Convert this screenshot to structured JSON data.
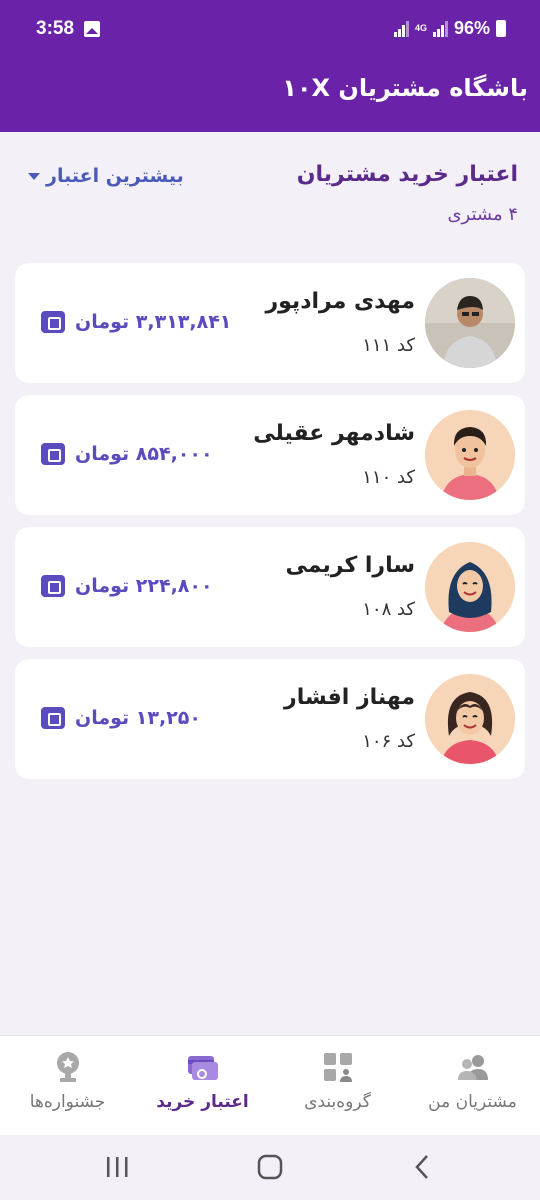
{
  "status_bar": {
    "time": "3:58",
    "network": "4G",
    "battery": "96%"
  },
  "app_bar": {
    "title": "باشگاه مشتریان ۱۰X"
  },
  "section": {
    "title": "اعتبار خرید مشتریان",
    "count": "۴ مشتری",
    "sort_label": "بیشترین اعتبار"
  },
  "customers": [
    {
      "name": "مهدی مرادپور",
      "code": "کد ۱۱۱",
      "credit": "۳,۳۱۳,۸۴۱ تومان"
    },
    {
      "name": "شادمهر عقیلی",
      "code": "کد ۱۱۰",
      "credit": "۸۵۴,۰۰۰ تومان"
    },
    {
      "name": "سارا کریمی",
      "code": "کد ۱۰۸",
      "credit": "۲۲۴,۸۰۰ تومان"
    },
    {
      "name": "مهناز افشار",
      "code": "کد ۱۰۶",
      "credit": "۱۳,۲۵۰ تومان"
    }
  ],
  "bottom_nav": {
    "customers": "مشتریان من",
    "grouping": "گروه‌بندی",
    "credit": "اعتبار خرید",
    "festivals": "جشنواره‌ها"
  },
  "colors": {
    "primary": "#6a22a8",
    "accent": "#5a4cbf",
    "background": "#f3f1f7"
  },
  "icons": [
    "wallet-icon",
    "users-icon",
    "grid-icon",
    "card-icon",
    "trophy-icon",
    "back-icon",
    "home-icon",
    "recents-icon"
  ]
}
